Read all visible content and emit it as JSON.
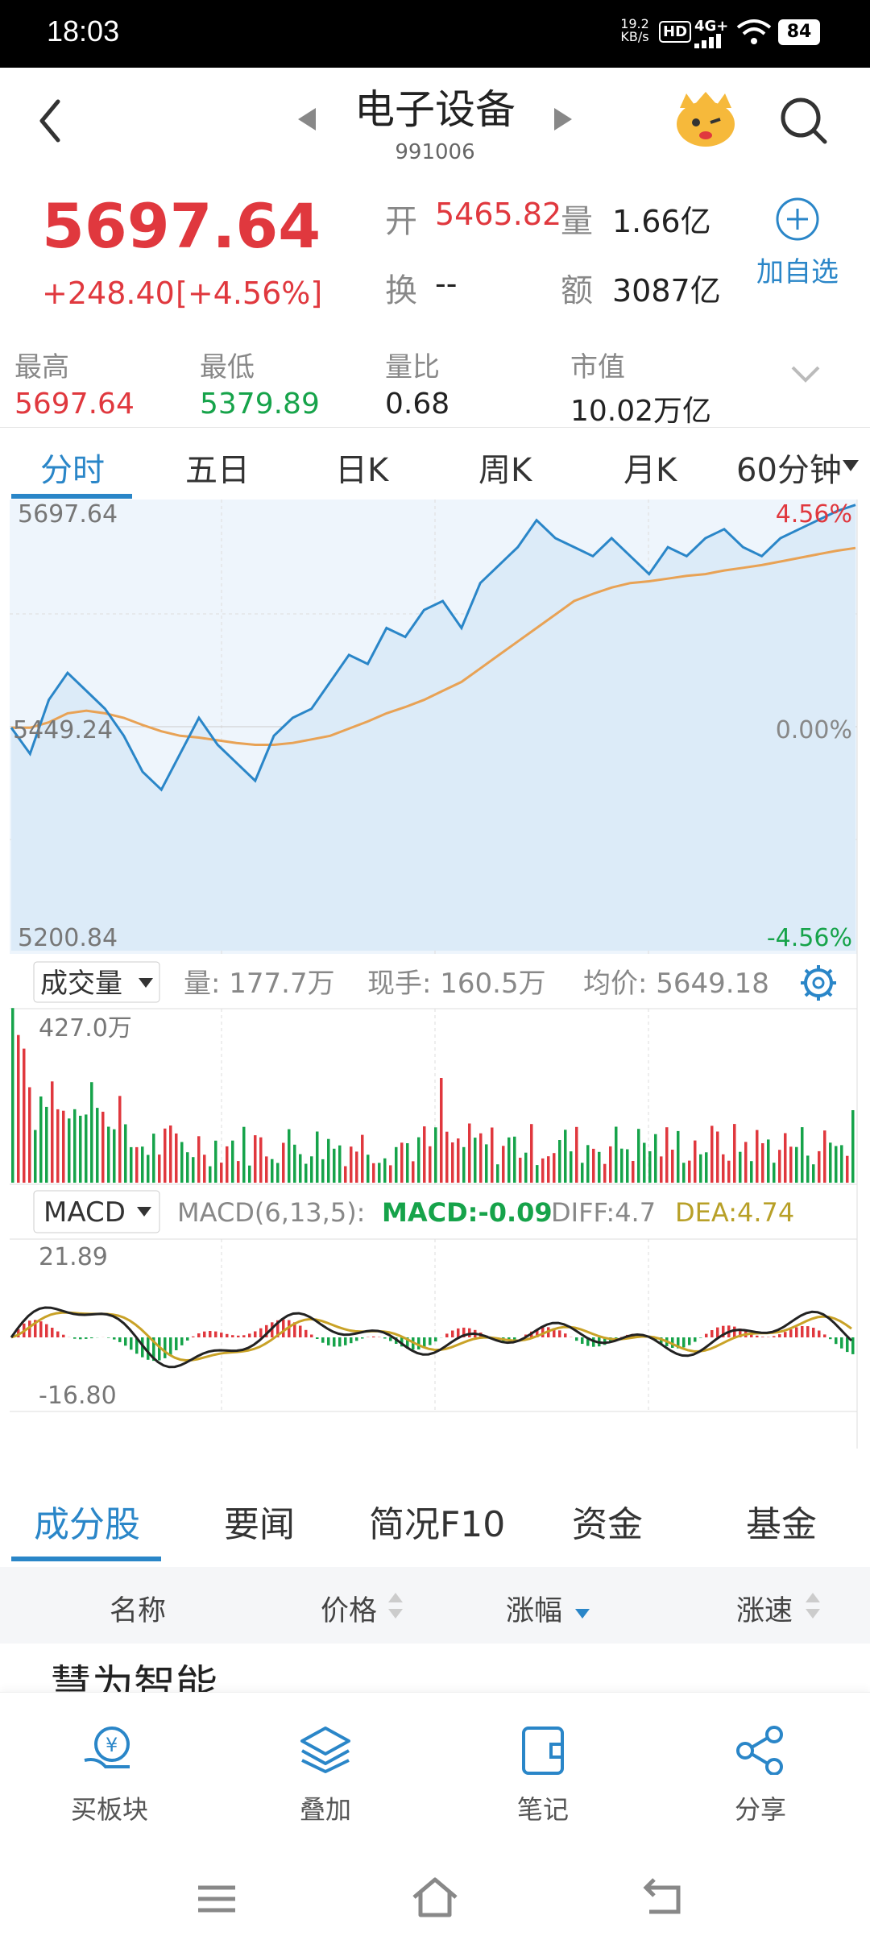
{
  "status_bar": {
    "time": "18:03",
    "net_speed_top": "19.2",
    "net_speed_unit": "KB/s",
    "hd": "HD",
    "signal": "4G+",
    "battery": "84"
  },
  "header": {
    "title": "电子设备",
    "code": "991006"
  },
  "quote": {
    "price": "5697.64",
    "change": "+248.40",
    "change_pct": "[+4.56%]",
    "open_label": "开",
    "open_value": "5465.82",
    "volume_label": "量",
    "volume_value": "1.66亿",
    "turnover_label": "换",
    "turnover_value": "--",
    "amount_label": "额",
    "amount_value": "3087亿",
    "add_label": "加自选"
  },
  "stats": [
    {
      "label": "最高",
      "value": "5697.64"
    },
    {
      "label": "最低",
      "value": "5379.89"
    },
    {
      "label": "量比",
      "value": "0.68"
    },
    {
      "label": "市值",
      "value": "10.02万亿"
    }
  ],
  "tabs": [
    "分时",
    "五日",
    "日K",
    "周K",
    "月K",
    "60分钟"
  ],
  "chart": {
    "price_high": "5697.64",
    "price_mid": "5449.24",
    "price_low": "5200.84",
    "pct_high": "4.56%",
    "pct_mid": "0.00%",
    "pct_low": "-4.56%",
    "volume_selector": "成交量",
    "volume_info": "量: 177.7万",
    "current_hand": "现手: 160.5万",
    "avg_price": "均价: 5649.18",
    "volume_max": "427.0万",
    "macd_selector": "MACD",
    "macd_params": "MACD(6,13,5):",
    "macd_value": "MACD:-0.09",
    "diff_value": "DIFF:4.7",
    "dea_value": "DEA:4.74",
    "macd_high": "21.89",
    "macd_low": "-16.80"
  },
  "chart_data": {
    "type": "line",
    "series": [
      {
        "values": [
          5449,
          5420,
          5480,
          5510,
          5490,
          5470,
          5440,
          5400,
          5380,
          5420,
          5460,
          5430,
          5410,
          5390,
          5440,
          5460,
          5470,
          5500,
          5530,
          5520,
          5560,
          5550,
          5580,
          5590,
          5560,
          5610,
          5630,
          5650,
          5680,
          5660,
          5650,
          5640,
          5660,
          5640,
          5620,
          5650,
          5640,
          5660,
          5670,
          5650,
          5640,
          5660,
          5670,
          5680,
          5690,
          5697
        ]
      },
      {
        "values": [
          5449,
          5449,
          5455,
          5465,
          5468,
          5465,
          5460,
          5452,
          5445,
          5440,
          5438,
          5435,
          5432,
          5430,
          5430,
          5432,
          5436,
          5440,
          5448,
          5456,
          5465,
          5472,
          5480,
          5490,
          5500,
          5515,
          5530,
          5545,
          5560,
          5575,
          5590,
          5598,
          5605,
          5610,
          5612,
          5615,
          5618,
          5620,
          5624,
          5627,
          5630,
          5634,
          5638,
          5642,
          5646,
          5649
        ]
      }
    ],
    "ylim": [
      5200.84,
      5697.64
    ]
  },
  "bottom_tabs": [
    "成分股",
    "要闻",
    "简况F10",
    "资金",
    "基金"
  ],
  "table_headers": [
    "名称",
    "价格",
    "涨幅",
    "涨速"
  ],
  "first_row_name": "慧为智能",
  "bottom_nav": [
    "买板块",
    "叠加",
    "笔记",
    "分享"
  ],
  "colors": {
    "accent": "#2a86c8",
    "up": "#e0383e",
    "down": "#16a34a",
    "avg": "#e8a255"
  }
}
